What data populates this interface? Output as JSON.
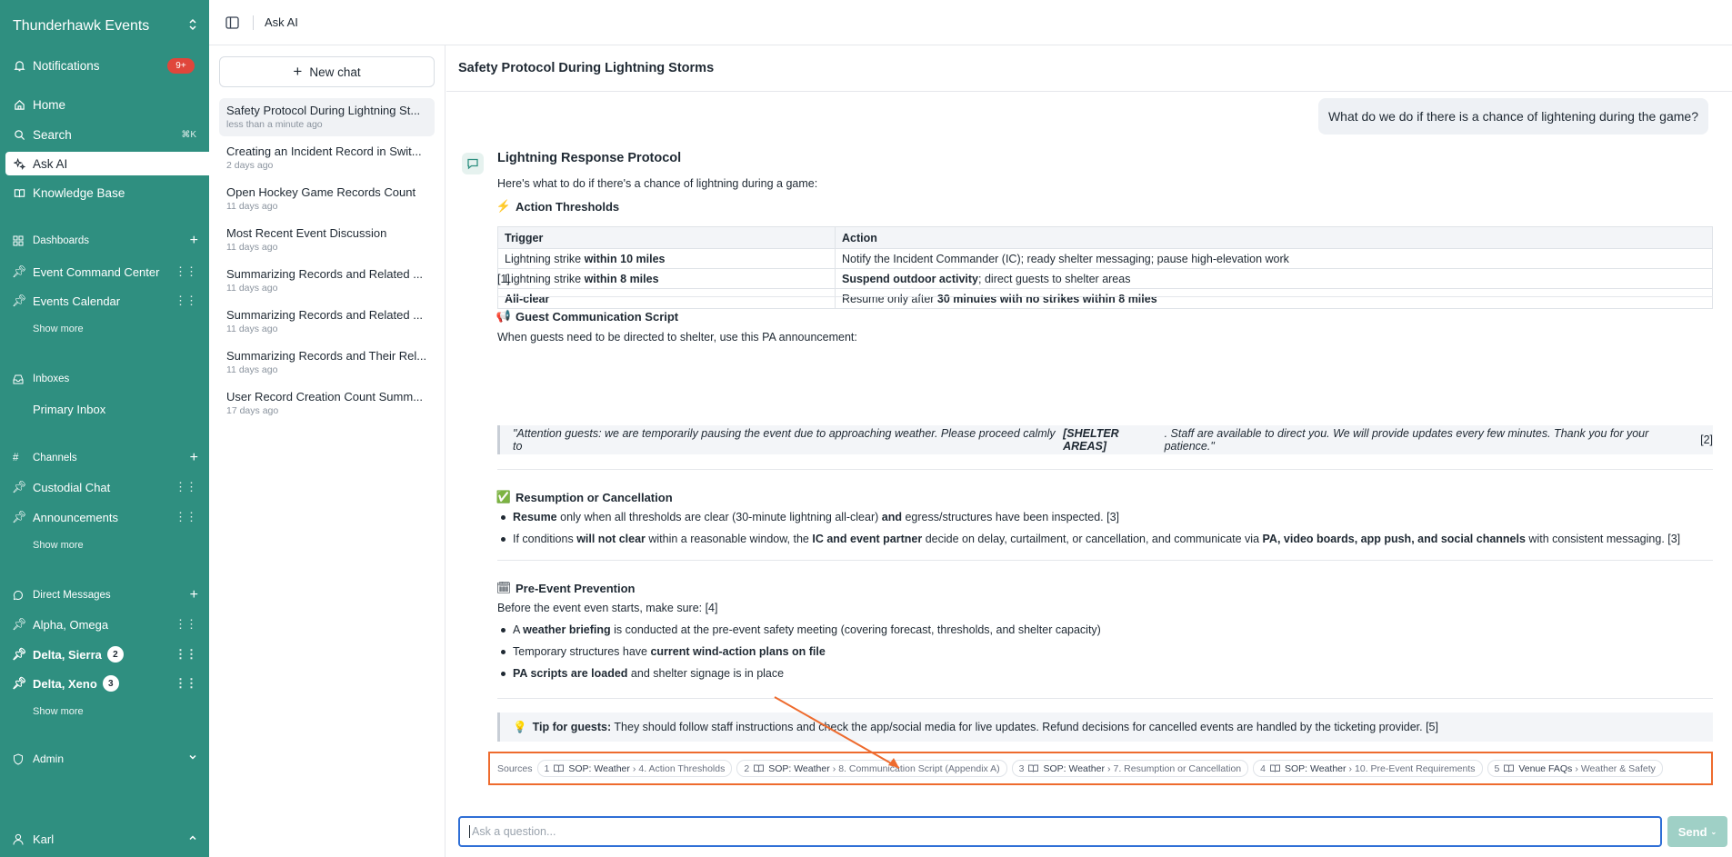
{
  "sidebar": {
    "workspace": "Thunderhawk Events",
    "notifications": {
      "label": "Notifications",
      "badge": "9+"
    },
    "nav": {
      "home": "Home",
      "search": "Search",
      "search_kbd": "⌘K",
      "ask_ai": "Ask AI",
      "knowledge_base": "Knowledge Base"
    },
    "dashboards": {
      "label": "Dashboards",
      "items": [
        "Event Command Center",
        "Events Calendar"
      ],
      "more": "Show more"
    },
    "inboxes": {
      "label": "Inboxes",
      "items": [
        "Primary Inbox"
      ]
    },
    "channels": {
      "label": "Channels",
      "items": [
        "Custodial Chat",
        "Announcements"
      ],
      "more": "Show more"
    },
    "direct_messages": {
      "label": "Direct Messages",
      "items": [
        {
          "name": "Alpha, Omega",
          "count": ""
        },
        {
          "name": "Delta, Sierra",
          "count": "2"
        },
        {
          "name": "Delta, Xeno",
          "count": "3"
        }
      ],
      "more": "Show more"
    },
    "admin": "Admin",
    "user": "Karl"
  },
  "topbar": {
    "breadcrumb": "Ask AI"
  },
  "chatlist": {
    "new_chat": "New chat",
    "chats": [
      {
        "title": "Safety Protocol During Lightning St...",
        "date": "less than a minute ago"
      },
      {
        "title": "Creating an Incident Record in Swit...",
        "date": "2 days ago"
      },
      {
        "title": "Open Hockey Game Records Count",
        "date": "11 days ago"
      },
      {
        "title": "Most Recent Event Discussion",
        "date": "11 days ago"
      },
      {
        "title": "Summarizing Records and Related ...",
        "date": "11 days ago"
      },
      {
        "title": "Summarizing Records and Related ...",
        "date": "11 days ago"
      },
      {
        "title": "Summarizing Records and Their Rel...",
        "date": "11 days ago"
      },
      {
        "title": "User Record Creation Count Summ...",
        "date": "17 days ago"
      }
    ]
  },
  "main": {
    "title": "Safety Protocol During Lightning Storms",
    "user_question": "What do we do if there is a chance of lightening during the game?",
    "answer": {
      "heading": "Lightning Response Protocol",
      "intro": "Here's what to do if there's a chance of lightning during a game:",
      "thresholds": {
        "icon": "⚡",
        "heading": "Action Thresholds",
        "headers": [
          "Trigger",
          "Action"
        ],
        "rows": [
          {
            "t_pre": "Lightning strike ",
            "t_bold": "within 10 miles",
            "a_pre": "",
            "a_bold": "",
            "a_post": "Notify the Incident Commander (IC); ready shelter messaging; pause high-elevation work"
          },
          {
            "t_pre": "Lightning strike ",
            "t_bold": "within 8 miles",
            "a_pre": "",
            "a_bold": "Suspend outdoor activity",
            "a_post": "; direct guests to shelter areas"
          },
          {
            "t_pre": "",
            "t_bold": "All-clear",
            "a_pre": "Resume only after ",
            "a_bold": "30 minutes with no strikes within 8 miles",
            "a_post": ""
          }
        ],
        "citation": "[1]"
      },
      "guest_comm": {
        "icon": "📢",
        "heading": "Guest Communication Script",
        "intro": "When guests need to be directed to shelter, use this PA announcement:",
        "quote_pre": "\"Attention guests: we are temporarily pausing the event due to approaching weather. Please proceed calmly to ",
        "quote_bold": "[SHELTER AREAS]",
        "quote_post": ". Staff are available to direct you. We will provide updates every few minutes. Thank you for your patience.\"",
        "citation": " [2]"
      },
      "resumption": {
        "icon": "✅",
        "heading": "Resumption or Cancellation",
        "b1": {
          "s1": "Resume",
          "s2": " only when all thresholds are clear (30-minute lightning all-clear) ",
          "s3": "and",
          "s4": " egress/structures have been inspected. [3]"
        },
        "b2": {
          "s1": "If conditions ",
          "s2": "will not clear",
          "s3": " within a reasonable window, the ",
          "s4": "IC and event partner",
          "s5": " decide on delay, curtailment, or cancellation, and communicate via ",
          "s6": "PA, video boards, app push, and social channels",
          "s7": " with consistent messaging. [3]"
        }
      },
      "prevention": {
        "icon": "🗓",
        "heading": "Pre-Event Prevention",
        "intro": "Before the event even starts, make sure: [4]",
        "b1": {
          "s1": "A ",
          "s2": "weather briefing",
          "s3": " is conducted at the pre-event safety meeting (covering forecast, thresholds, and shelter capacity)"
        },
        "b2": {
          "s1": "Temporary structures have ",
          "s2": "current wind-action plans on file",
          "s3": ""
        },
        "b3": {
          "s1": "",
          "s2": "PA scripts are loaded",
          "s3": " and shelter signage is in place"
        }
      },
      "tip": {
        "icon": "💡",
        "bold": "Tip for guests:",
        "text": " They should follow staff instructions and check the app/social media for live updates. Refund decisions for cancelled events are handled by the ticketing provider. [5]"
      }
    },
    "sources": {
      "label": "Sources",
      "items": [
        {
          "num": "1",
          "doc": "SOP: Weather",
          "section": "4. Action Thresholds"
        },
        {
          "num": "2",
          "doc": "SOP: Weather",
          "section": "8. Communication Script (Appendix A)"
        },
        {
          "num": "3",
          "doc": "SOP: Weather",
          "section": "7. Resumption or Cancellation"
        },
        {
          "num": "4",
          "doc": "SOP: Weather",
          "section": "10. Pre-Event Requirements"
        },
        {
          "num": "5",
          "doc": "Venue FAQs",
          "section": "Weather & Safety"
        }
      ]
    },
    "composer": {
      "placeholder": "Ask a question...",
      "send": "Send"
    }
  },
  "colors": {
    "sidebar": "#2f8f80",
    "highlight": "#ee6b2e",
    "focus": "#2f6fd6"
  }
}
